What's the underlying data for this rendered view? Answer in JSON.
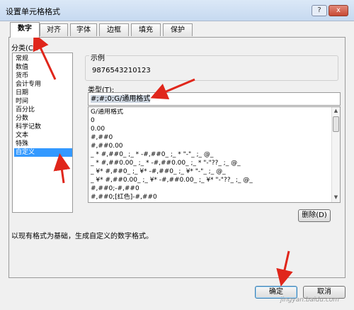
{
  "window": {
    "title": "设置单元格格式",
    "help_glyph": "?",
    "close_glyph": "x"
  },
  "tabs": [
    {
      "label": "数字"
    },
    {
      "label": "对齐"
    },
    {
      "label": "字体"
    },
    {
      "label": "边框"
    },
    {
      "label": "填充"
    },
    {
      "label": "保护"
    }
  ],
  "category": {
    "label": "分类(C):",
    "items": [
      "常规",
      "数值",
      "货币",
      "会计专用",
      "日期",
      "时间",
      "百分比",
      "分数",
      "科学记数",
      "文本",
      "特殊",
      "自定义"
    ],
    "selected": "自定义"
  },
  "sample": {
    "label": "示例",
    "value": "9876543210123"
  },
  "type": {
    "label": "类型(T):",
    "value": "#;#;0;G/通用格式",
    "formats": [
      "G/通用格式",
      "0",
      "0.00",
      "#,##0",
      "#,##0.00",
      "_ * #,##0_ ;_ * -#,##0_ ;_ * \"-\"_ ;_ @_",
      "_ * #,##0.00_ ;_ * -#,##0.00_ ;_ * \"-\"??_ ;_ @_",
      "_ ¥* #,##0_ ;_ ¥* -#,##0_ ;_ ¥* \"-\"_ ;_ @_",
      "_ ¥* #,##0.00_ ;_ ¥* -#,##0.00_ ;_ ¥* \"-\"??_ ;_ @_",
      "#,##0;-#,##0",
      "#,##0;[红色]-#,##0"
    ]
  },
  "delete_label": "删除(D)",
  "description": "以现有格式为基础，生成自定义的数字格式。",
  "ok_label": "确定",
  "cancel_label": "取消",
  "watermark": "jingyan.baidu.com",
  "colors": {
    "accent": "#3399ff",
    "annotation": "#e0261b"
  }
}
